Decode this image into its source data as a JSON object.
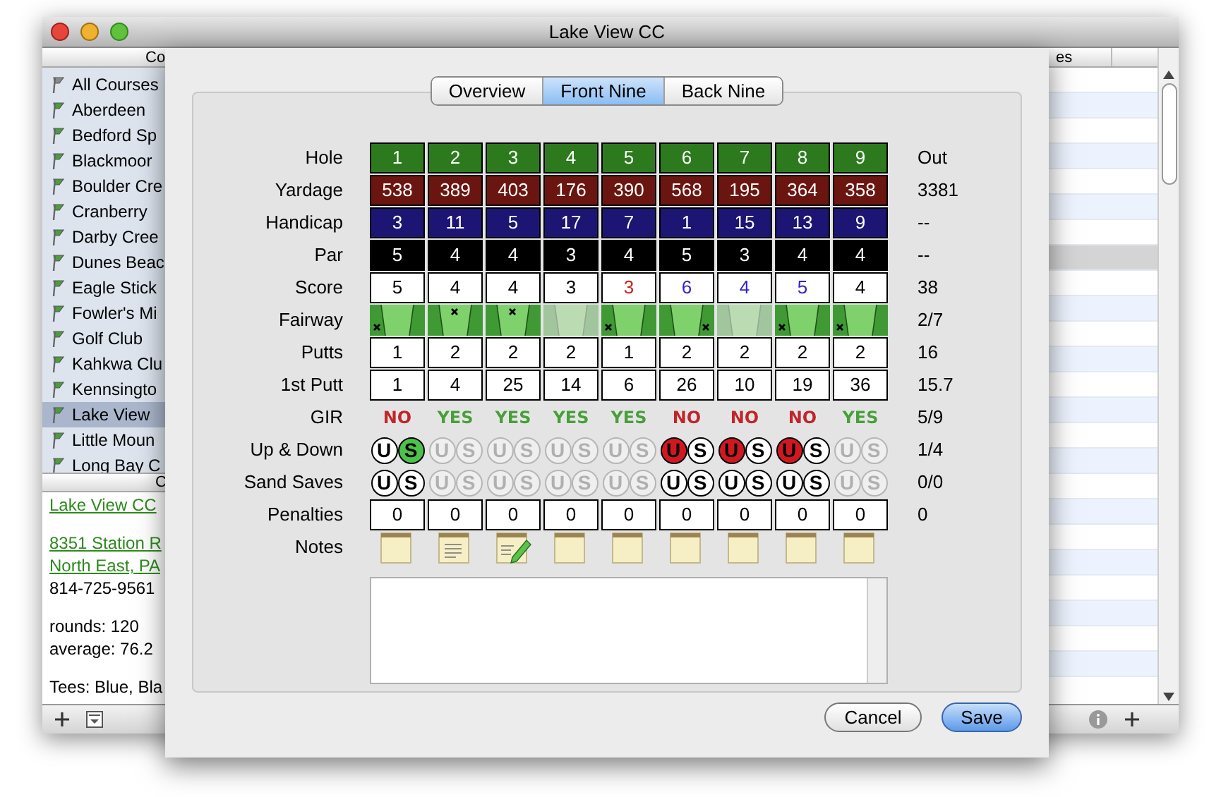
{
  "window": {
    "title": "Lake View CC"
  },
  "courses": {
    "header": "Co",
    "items": [
      {
        "name": "All Courses",
        "kind": "all",
        "selected": false
      },
      {
        "name": "Aberdeen",
        "kind": "course",
        "selected": false
      },
      {
        "name": "Bedford Sp",
        "kind": "course",
        "selected": false
      },
      {
        "name": "Blackmoor",
        "kind": "course",
        "selected": false
      },
      {
        "name": "Boulder Cre",
        "kind": "course",
        "selected": false
      },
      {
        "name": "Cranberry",
        "kind": "course",
        "selected": false
      },
      {
        "name": "Darby Cree",
        "kind": "course",
        "selected": false
      },
      {
        "name": "Dunes Beac",
        "kind": "course",
        "selected": false
      },
      {
        "name": "Eagle Stick",
        "kind": "course",
        "selected": false
      },
      {
        "name": "Fowler's Mi",
        "kind": "course",
        "selected": false
      },
      {
        "name": "Golf Club",
        "kind": "course",
        "selected": false
      },
      {
        "name": "Kahkwa Clu",
        "kind": "course",
        "selected": false
      },
      {
        "name": "Kennsingto",
        "kind": "course",
        "selected": false
      },
      {
        "name": "Lake View",
        "kind": "course",
        "selected": true
      },
      {
        "name": "Little Moun",
        "kind": "course",
        "selected": false
      },
      {
        "name": "Long Bay C",
        "kind": "course",
        "selected": false
      }
    ]
  },
  "course_info": {
    "header": "C",
    "name_link": "Lake View CC",
    "address_links": [
      "8351 Station R",
      "North East, PA"
    ],
    "phone": "814-725-9561",
    "stats": [
      "rounds: 120",
      "average: 76.2"
    ],
    "tees": "Tees: Blue, Bla"
  },
  "rounds_table": {
    "header": "es",
    "rows": [
      {
        "selected": false
      },
      {
        "selected": false
      },
      {
        "selected": false
      },
      {
        "selected": false
      },
      {
        "selected": false
      },
      {
        "selected": false
      },
      {
        "selected": false
      },
      {
        "selected": true
      },
      {
        "selected": false
      },
      {
        "selected": false
      },
      {
        "selected": false
      },
      {
        "selected": false
      },
      {
        "selected": false
      },
      {
        "selected": false
      },
      {
        "selected": false
      },
      {
        "selected": false
      },
      {
        "selected": false
      },
      {
        "selected": false
      },
      {
        "selected": false
      },
      {
        "selected": false
      },
      {
        "selected": false
      },
      {
        "selected": false
      },
      {
        "selected": false
      },
      {
        "selected": false
      }
    ]
  },
  "sheet": {
    "tabs": [
      {
        "label": "Overview",
        "selected": false
      },
      {
        "label": "Front Nine",
        "selected": true
      },
      {
        "label": "Back Nine",
        "selected": false
      }
    ],
    "rows": [
      {
        "label": "Hole",
        "kind": "hole",
        "total": "Out",
        "cells": [
          "1",
          "2",
          "3",
          "4",
          "5",
          "6",
          "7",
          "8",
          "9"
        ]
      },
      {
        "label": "Yardage",
        "kind": "yardage",
        "total": "3381",
        "cells": [
          "538",
          "389",
          "403",
          "176",
          "390",
          "568",
          "195",
          "364",
          "358"
        ]
      },
      {
        "label": "Handicap",
        "kind": "handicap",
        "total": "--",
        "cells": [
          "3",
          "11",
          "5",
          "17",
          "7",
          "1",
          "15",
          "13",
          "9"
        ]
      },
      {
        "label": "Par",
        "kind": "par",
        "total": "--",
        "cells": [
          "5",
          "4",
          "4",
          "3",
          "4",
          "5",
          "3",
          "4",
          "4"
        ]
      },
      {
        "label": "Score",
        "kind": "score",
        "total": "38",
        "cells": [
          {
            "value": "5",
            "color": "#000000"
          },
          {
            "value": "4",
            "color": "#000000"
          },
          {
            "value": "4",
            "color": "#000000"
          },
          {
            "value": "3",
            "color": "#000000"
          },
          {
            "value": "3",
            "color": "#cc2222"
          },
          {
            "value": "6",
            "color": "#3322cc"
          },
          {
            "value": "4",
            "color": "#3322cc"
          },
          {
            "value": "5",
            "color": "#3322cc"
          },
          {
            "value": "4",
            "color": "#000000"
          }
        ]
      },
      {
        "label": "Fairway",
        "kind": "fairway",
        "total": "2/7",
        "cells": [
          {
            "missed_left": true,
            "hit": false,
            "missed_right": false,
            "disabled": false
          },
          {
            "missed_left": false,
            "hit": true,
            "missed_right": false,
            "disabled": false
          },
          {
            "missed_left": false,
            "hit": true,
            "missed_right": false,
            "disabled": false
          },
          {
            "missed_left": false,
            "hit": false,
            "missed_right": false,
            "disabled": true
          },
          {
            "missed_left": true,
            "hit": false,
            "missed_right": false,
            "disabled": false
          },
          {
            "missed_left": false,
            "hit": false,
            "missed_right": true,
            "disabled": false
          },
          {
            "missed_left": false,
            "hit": false,
            "missed_right": false,
            "disabled": true
          },
          {
            "missed_left": true,
            "hit": false,
            "missed_right": false,
            "disabled": false
          },
          {
            "missed_left": true,
            "hit": false,
            "missed_right": false,
            "disabled": false
          }
        ]
      },
      {
        "label": "Putts",
        "kind": "entry",
        "total": "16",
        "cells": [
          "1",
          "2",
          "2",
          "2",
          "1",
          "2",
          "2",
          "2",
          "2"
        ]
      },
      {
        "label": "1st Putt",
        "kind": "entry",
        "total": "15.7",
        "cells": [
          "1",
          "4",
          "25",
          "14",
          "6",
          "26",
          "10",
          "19",
          "36"
        ]
      },
      {
        "label": "GIR",
        "kind": "gir",
        "total": "5/9",
        "cells": [
          {
            "text": "NO",
            "hit": false
          },
          {
            "text": "YES",
            "hit": true
          },
          {
            "text": "YES",
            "hit": true
          },
          {
            "text": "YES",
            "hit": true
          },
          {
            "text": "YES",
            "hit": true
          },
          {
            "text": "NO",
            "hit": false
          },
          {
            "text": "NO",
            "hit": false
          },
          {
            "text": "NO",
            "hit": false
          },
          {
            "text": "YES",
            "hit": true
          }
        ]
      },
      {
        "label": "Up & Down",
        "kind": "toggle",
        "total": "1/4",
        "cells": [
          {
            "u": "U",
            "s": "S",
            "enabled": true,
            "u_selected": false,
            "s_selected": true
          },
          {
            "u": "U",
            "s": "S",
            "enabled": false,
            "u_selected": false,
            "s_selected": false
          },
          {
            "u": "U",
            "s": "S",
            "enabled": false,
            "u_selected": false,
            "s_selected": false
          },
          {
            "u": "U",
            "s": "S",
            "enabled": false,
            "u_selected": false,
            "s_selected": false
          },
          {
            "u": "U",
            "s": "S",
            "enabled": false,
            "u_selected": false,
            "s_selected": false
          },
          {
            "u": "U",
            "s": "S",
            "enabled": true,
            "u_selected": true,
            "s_selected": false
          },
          {
            "u": "U",
            "s": "S",
            "enabled": true,
            "u_selected": true,
            "s_selected": false
          },
          {
            "u": "U",
            "s": "S",
            "enabled": true,
            "u_selected": true,
            "s_selected": false
          },
          {
            "u": "U",
            "s": "S",
            "enabled": false,
            "u_selected": false,
            "s_selected": false
          }
        ]
      },
      {
        "label": "Sand Saves",
        "kind": "toggle",
        "total": "0/0",
        "cells": [
          {
            "u": "U",
            "s": "S",
            "enabled": true,
            "u_selected": false,
            "s_selected": false
          },
          {
            "u": "U",
            "s": "S",
            "enabled": false,
            "u_selected": false,
            "s_selected": false
          },
          {
            "u": "U",
            "s": "S",
            "enabled": false,
            "u_selected": false,
            "s_selected": false
          },
          {
            "u": "U",
            "s": "S",
            "enabled": false,
            "u_selected": false,
            "s_selected": false
          },
          {
            "u": "U",
            "s": "S",
            "enabled": false,
            "u_selected": false,
            "s_selected": false
          },
          {
            "u": "U",
            "s": "S",
            "enabled": true,
            "u_selected": false,
            "s_selected": false
          },
          {
            "u": "U",
            "s": "S",
            "enabled": true,
            "u_selected": false,
            "s_selected": false
          },
          {
            "u": "U",
            "s": "S",
            "enabled": true,
            "u_selected": false,
            "s_selected": false
          },
          {
            "u": "U",
            "s": "S",
            "enabled": false,
            "u_selected": false,
            "s_selected": false
          }
        ]
      },
      {
        "label": "Penalties",
        "kind": "entry",
        "total": "0",
        "cells": [
          "0",
          "0",
          "0",
          "0",
          "0",
          "0",
          "0",
          "0",
          "0"
        ]
      },
      {
        "label": "Notes",
        "kind": "notes",
        "cells": [
          {
            "kind": "empty"
          },
          {
            "kind": "written"
          },
          {
            "kind": "editing"
          },
          {
            "kind": "empty"
          },
          {
            "kind": "empty"
          },
          {
            "kind": "empty"
          },
          {
            "kind": "empty"
          },
          {
            "kind": "empty"
          },
          {
            "kind": "empty"
          }
        ]
      }
    ],
    "buttons": [
      {
        "label": "Cancel",
        "kind": "default"
      },
      {
        "label": "Save",
        "kind": "primary"
      }
    ]
  }
}
